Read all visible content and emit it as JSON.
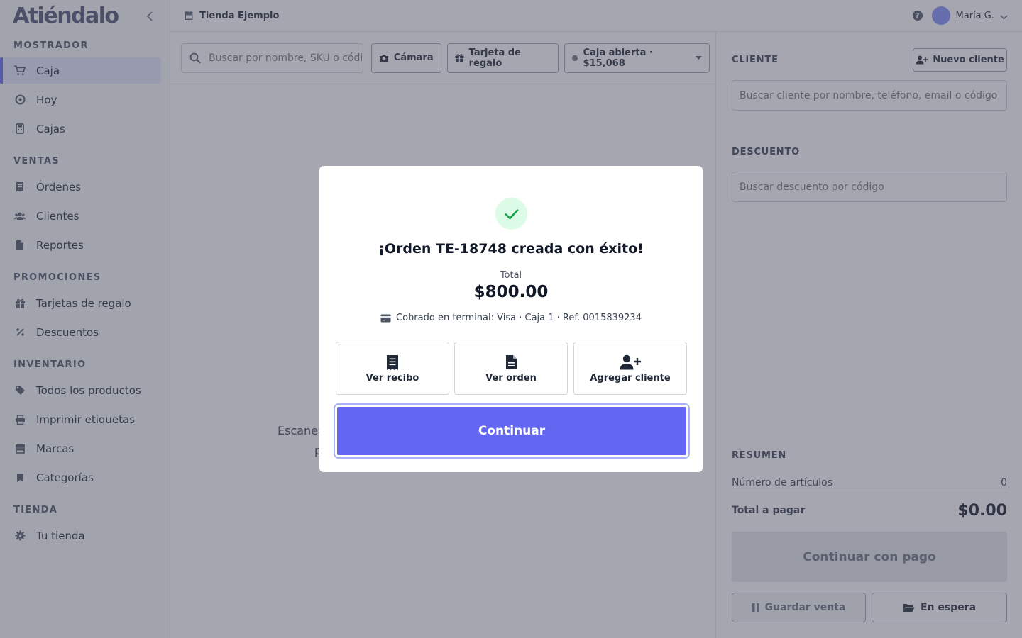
{
  "app": {
    "logo_text": "Atiéndalo",
    "store_name": "Tienda Ejemplo",
    "user_name": "María G."
  },
  "sidebar": {
    "sections": [
      {
        "title": "MOSTRADOR",
        "items": [
          {
            "label": "Caja",
            "icon": "cart-icon",
            "active": true
          },
          {
            "label": "Hoy",
            "icon": "gauge-icon"
          },
          {
            "label": "Cajas",
            "icon": "calculator-icon"
          }
        ]
      },
      {
        "title": "VENTAS",
        "items": [
          {
            "label": "Órdenes",
            "icon": "receipt-icon"
          },
          {
            "label": "Clientes",
            "icon": "users-icon"
          },
          {
            "label": "Reportes",
            "icon": "file-icon"
          }
        ]
      },
      {
        "title": "PROMOCIONES",
        "items": [
          {
            "label": "Tarjetas de regalo",
            "icon": "gift-icon"
          },
          {
            "label": "Descuentos",
            "icon": "percent-icon"
          }
        ]
      },
      {
        "title": "INVENTARIO",
        "items": [
          {
            "label": "Todos los productos",
            "icon": "tag-icon"
          },
          {
            "label": "Imprimir etiquetas",
            "icon": "printer-icon"
          },
          {
            "label": "Marcas",
            "icon": "store-icon"
          },
          {
            "label": "Categorías",
            "icon": "bookmark-icon"
          }
        ]
      },
      {
        "title": "TIENDA",
        "items": [
          {
            "label": "Tu tienda",
            "icon": "gear-icon"
          }
        ]
      }
    ]
  },
  "toolbar": {
    "search_placeholder": "Buscar por nombre, SKU o código de barras",
    "camera_label": "Cámara",
    "gift_card_label": "Tarjeta de regalo",
    "register_label": "Caja abierta · $15,068"
  },
  "main": {
    "hint_line1": "Escanea",
    "hint_line2": "p"
  },
  "right_panel": {
    "client_label": "CLIENTE",
    "new_client_label": "Nuevo cliente",
    "client_search_placeholder": "Buscar cliente por nombre, teléfono, email o código",
    "discount_label": "DESCUENTO",
    "discount_placeholder": "Buscar descuento por código",
    "summary_label": "RESUMEN",
    "items_count_label": "Número de artículos",
    "items_count_value": "0",
    "total_label": "Total a pagar",
    "total_value": "$0.00",
    "pay_button": "Continuar con pago",
    "save_sale_button": "Guardar venta",
    "on_hold_button": "En espera"
  },
  "modal": {
    "title": "¡Orden TE-18748 creada con éxito!",
    "total_label": "Total",
    "total_value": "$800.00",
    "payment_info": "Cobrado en terminal: Visa · Caja 1 · Ref. 0015839234",
    "actions": [
      {
        "label": "Ver recibo",
        "icon": "receipt-icon"
      },
      {
        "label": "Ver orden",
        "icon": "document-icon"
      },
      {
        "label": "Agregar cliente",
        "icon": "user-plus-icon"
      }
    ],
    "continue_button": "Continuar"
  },
  "colors": {
    "accent": "#6366f1",
    "success_bg": "#dcfce7",
    "success_check": "#16a34a"
  }
}
